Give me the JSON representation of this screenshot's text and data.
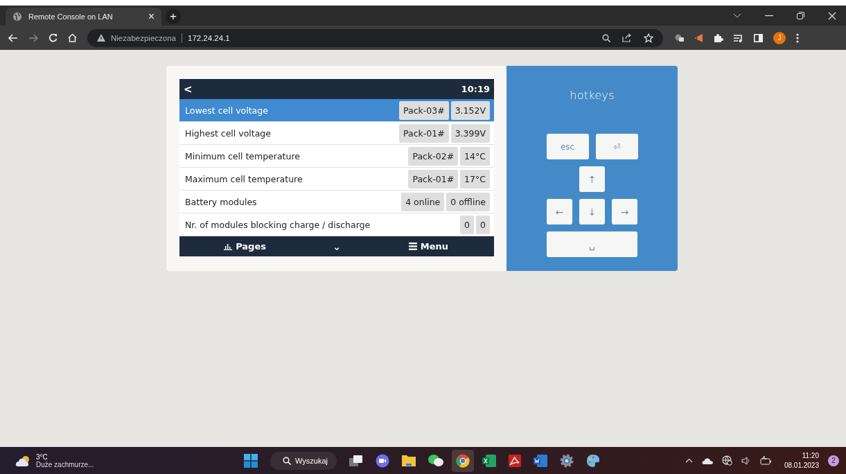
{
  "browser": {
    "tabs": [
      {
        "title": "Remote Console on LAN",
        "close": "×",
        "selected": true
      }
    ],
    "new_tab": "+",
    "security_label": "Niezabezpieczona",
    "url": "172.24.24.1",
    "avatar": "J"
  },
  "console": {
    "back": "<",
    "time": "10:19",
    "rows": [
      {
        "label": "Lowest cell voltage",
        "values": [
          "Pack-03#",
          "3.152V"
        ],
        "selected": true
      },
      {
        "label": "Highest cell voltage",
        "values": [
          "Pack-01#",
          "3.399V"
        ],
        "selected": false
      },
      {
        "label": "Minimum cell temperature",
        "values": [
          "Pack-02#",
          "14°C"
        ],
        "selected": false
      },
      {
        "label": "Maximum cell temperature",
        "values": [
          "Pack-01#",
          "17°C"
        ],
        "selected": false
      },
      {
        "label": "Battery modules",
        "values": [
          "4 online",
          "0 offline"
        ],
        "selected": false
      },
      {
        "label": "Nr. of modules blocking charge / discharge",
        "values": [
          "0",
          "0"
        ],
        "selected": false
      }
    ],
    "footer": {
      "pages": "Pages",
      "chevron": "⌄",
      "menu": "Menu"
    }
  },
  "hotkeys": {
    "title": "hotkeys",
    "keys": [
      {
        "kind": "text",
        "label": "esc"
      },
      {
        "kind": "enter",
        "label": "⏎"
      },
      {
        "kind": "up",
        "label": "↑"
      },
      {
        "kind": "left",
        "label": "←"
      },
      {
        "kind": "down",
        "label": "↓"
      },
      {
        "kind": "right",
        "label": "→"
      },
      {
        "kind": "space",
        "label": "␣"
      }
    ]
  },
  "taskbar": {
    "weather": {
      "temp": "3°C",
      "text": "Duże zachmurze..."
    },
    "search": "Wyszukaj",
    "time": "11:20",
    "date": "08.01.2023",
    "badge": "2"
  }
}
